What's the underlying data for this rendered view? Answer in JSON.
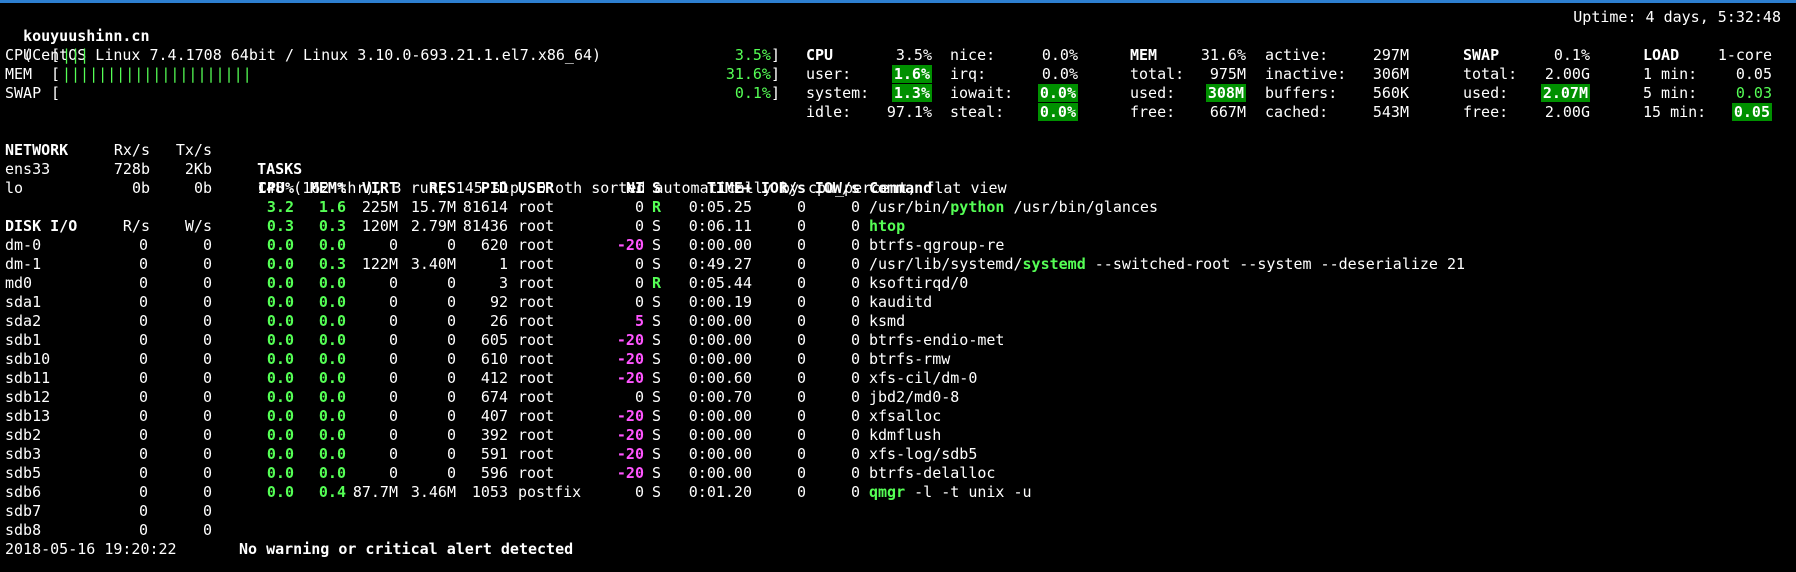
{
  "header": {
    "hostname": "kouyuushinn.cn",
    "system": "(CentOS Linux 7.4.1708 64bit / Linux 3.10.0-693.21.1.el7.x86_64)",
    "uptime": "Uptime: 4 days, 5:32:48"
  },
  "quicklook": [
    {
      "label": "CPU",
      "bar": "|||",
      "pct": "3.5%]"
    },
    {
      "label": "MEM",
      "bar": "|||||||||||||||||||||",
      "pct": "31.6%]"
    },
    {
      "label": "SWAP",
      "bar": "",
      "pct": "0.1%]"
    }
  ],
  "cpu": {
    "title": "CPU",
    "total": "3.5%",
    "user_label": "user:",
    "user": "1.6%",
    "system_label": "system:",
    "system": "1.3%",
    "idle_label": "idle:",
    "idle": "97.1%",
    "nice_label": "nice:",
    "nice": "0.0%",
    "irq_label": "irq:",
    "irq": "0.0%",
    "iowait_label": "iowait:",
    "iowait": "0.0%",
    "steal_label": "steal:",
    "steal": "0.0%"
  },
  "mem": {
    "title": "MEM",
    "pct": "31.6%",
    "total_label": "total:",
    "total": "975M",
    "used_label": "used:",
    "used": "308M",
    "free_label": "free:",
    "free": "667M",
    "active_label": "active:",
    "active": "297M",
    "inactive_label": "inactive:",
    "inactive": "306M",
    "buffers_label": "buffers:",
    "buffers": "560K",
    "cached_label": "cached:",
    "cached": "543M"
  },
  "swap": {
    "title": "SWAP",
    "pct": "0.1%",
    "total_label": "total:",
    "total": "2.00G",
    "used_label": "used:",
    "used": "2.07M",
    "free_label": "free:",
    "free": "2.00G"
  },
  "load": {
    "title": "LOAD",
    "cores": "1-core",
    "min1_label": "1 min:",
    "min1": "0.05",
    "min5_label": "5 min:",
    "min5": "0.03",
    "min15_label": "15 min:",
    "min15": "0.05"
  },
  "network": {
    "title": "NETWORK",
    "rx_header": "Rx/s",
    "tx_header": "Tx/s",
    "rows": [
      {
        "name": "ens33",
        "rx": "728b",
        "tx": "2Kb"
      },
      {
        "name": "lo",
        "rx": "0b",
        "tx": "0b"
      }
    ]
  },
  "disk": {
    "title": "DISK I/O",
    "r_header": "R/s",
    "w_header": "W/s",
    "rows": [
      {
        "name": "dm-0",
        "r": "0",
        "w": "0"
      },
      {
        "name": "dm-1",
        "r": "0",
        "w": "0"
      },
      {
        "name": "md0",
        "r": "0",
        "w": "0"
      },
      {
        "name": "sda1",
        "r": "0",
        "w": "0"
      },
      {
        "name": "sda2",
        "r": "0",
        "w": "0"
      },
      {
        "name": "sdb1",
        "r": "0",
        "w": "0"
      },
      {
        "name": "sdb10",
        "r": "0",
        "w": "0"
      },
      {
        "name": "sdb11",
        "r": "0",
        "w": "0"
      },
      {
        "name": "sdb12",
        "r": "0",
        "w": "0"
      },
      {
        "name": "sdb13",
        "r": "0",
        "w": "0"
      },
      {
        "name": "sdb2",
        "r": "0",
        "w": "0"
      },
      {
        "name": "sdb3",
        "r": "0",
        "w": "0"
      },
      {
        "name": "sdb5",
        "r": "0",
        "w": "0"
      },
      {
        "name": "sdb6",
        "r": "0",
        "w": "0"
      },
      {
        "name": "sdb7",
        "r": "0",
        "w": "0"
      },
      {
        "name": "sdb8",
        "r": "0",
        "w": "0"
      }
    ]
  },
  "tasks": {
    "title": "TASKS",
    "summary": "148 (162 thr), 3 run, 145 slp, 0 oth sorted automatically by cpu_percent, flat view"
  },
  "process_headers": [
    "CPU%",
    "MEM%",
    "VIRT",
    "RES",
    "PID",
    "USER",
    "NI",
    "S",
    "TIME+",
    "IOR/s",
    "IOW/s",
    "Command"
  ],
  "processes": [
    {
      "cpu": "3.2",
      "mem": "1.6",
      "virt": "225M",
      "res": "15.7M",
      "pid": "81614",
      "user": "root",
      "ni": "0",
      "ni_neg": false,
      "s": "R",
      "time": "0:05.25",
      "ior": "0",
      "iow": "0",
      "cmd_pre": "/usr/bin/",
      "cmd_hl": "python",
      "cmd_post": " /usr/bin/glances",
      "hot": true
    },
    {
      "cpu": "0.3",
      "mem": "0.3",
      "virt": "120M",
      "res": "2.79M",
      "pid": "81436",
      "user": "root",
      "ni": "0",
      "ni_neg": false,
      "s": "S",
      "time": "0:06.11",
      "ior": "0",
      "iow": "0",
      "cmd_pre": "",
      "cmd_hl": "htop",
      "cmd_post": "",
      "hot": true
    },
    {
      "cpu": "0.0",
      "mem": "0.0",
      "virt": "0",
      "res": "0",
      "pid": "620",
      "user": "root",
      "ni": "-20",
      "ni_neg": true,
      "s": "S",
      "time": "0:00.00",
      "ior": "0",
      "iow": "0",
      "cmd_pre": "btrfs-qgroup-re",
      "cmd_hl": "",
      "cmd_post": "",
      "hot": false
    },
    {
      "cpu": "0.0",
      "mem": "0.3",
      "virt": "122M",
      "res": "3.40M",
      "pid": "1",
      "user": "root",
      "ni": "0",
      "ni_neg": false,
      "s": "S",
      "time": "0:49.27",
      "ior": "0",
      "iow": "0",
      "cmd_pre": "/usr/lib/systemd/",
      "cmd_hl": "systemd",
      "cmd_post": " --switched-root --system --deserialize 21",
      "hot": false
    },
    {
      "cpu": "0.0",
      "mem": "0.0",
      "virt": "0",
      "res": "0",
      "pid": "3",
      "user": "root",
      "ni": "0",
      "ni_neg": false,
      "s": "R",
      "time": "0:05.44",
      "ior": "0",
      "iow": "0",
      "cmd_pre": "ksoftirqd/0",
      "cmd_hl": "",
      "cmd_post": "",
      "hot": false
    },
    {
      "cpu": "0.0",
      "mem": "0.0",
      "virt": "0",
      "res": "0",
      "pid": "92",
      "user": "root",
      "ni": "0",
      "ni_neg": false,
      "s": "S",
      "time": "0:00.19",
      "ior": "0",
      "iow": "0",
      "cmd_pre": "kauditd",
      "cmd_hl": "",
      "cmd_post": "",
      "hot": false
    },
    {
      "cpu": "0.0",
      "mem": "0.0",
      "virt": "0",
      "res": "0",
      "pid": "26",
      "user": "root",
      "ni": "5",
      "ni_neg": true,
      "s": "S",
      "time": "0:00.00",
      "ior": "0",
      "iow": "0",
      "cmd_pre": "ksmd",
      "cmd_hl": "",
      "cmd_post": "",
      "hot": false
    },
    {
      "cpu": "0.0",
      "mem": "0.0",
      "virt": "0",
      "res": "0",
      "pid": "605",
      "user": "root",
      "ni": "-20",
      "ni_neg": true,
      "s": "S",
      "time": "0:00.00",
      "ior": "0",
      "iow": "0",
      "cmd_pre": "btrfs-endio-met",
      "cmd_hl": "",
      "cmd_post": "",
      "hot": false
    },
    {
      "cpu": "0.0",
      "mem": "0.0",
      "virt": "0",
      "res": "0",
      "pid": "610",
      "user": "root",
      "ni": "-20",
      "ni_neg": true,
      "s": "S",
      "time": "0:00.00",
      "ior": "0",
      "iow": "0",
      "cmd_pre": "btrfs-rmw",
      "cmd_hl": "",
      "cmd_post": "",
      "hot": false
    },
    {
      "cpu": "0.0",
      "mem": "0.0",
      "virt": "0",
      "res": "0",
      "pid": "412",
      "user": "root",
      "ni": "-20",
      "ni_neg": true,
      "s": "S",
      "time": "0:00.60",
      "ior": "0",
      "iow": "0",
      "cmd_pre": "xfs-cil/dm-0",
      "cmd_hl": "",
      "cmd_post": "",
      "hot": false
    },
    {
      "cpu": "0.0",
      "mem": "0.0",
      "virt": "0",
      "res": "0",
      "pid": "674",
      "user": "root",
      "ni": "0",
      "ni_neg": false,
      "s": "S",
      "time": "0:00.70",
      "ior": "0",
      "iow": "0",
      "cmd_pre": "jbd2/md0-8",
      "cmd_hl": "",
      "cmd_post": "",
      "hot": false
    },
    {
      "cpu": "0.0",
      "mem": "0.0",
      "virt": "0",
      "res": "0",
      "pid": "407",
      "user": "root",
      "ni": "-20",
      "ni_neg": true,
      "s": "S",
      "time": "0:00.00",
      "ior": "0",
      "iow": "0",
      "cmd_pre": "xfsalloc",
      "cmd_hl": "",
      "cmd_post": "",
      "hot": false
    },
    {
      "cpu": "0.0",
      "mem": "0.0",
      "virt": "0",
      "res": "0",
      "pid": "392",
      "user": "root",
      "ni": "-20",
      "ni_neg": true,
      "s": "S",
      "time": "0:00.00",
      "ior": "0",
      "iow": "0",
      "cmd_pre": "kdmflush",
      "cmd_hl": "",
      "cmd_post": "",
      "hot": false
    },
    {
      "cpu": "0.0",
      "mem": "0.0",
      "virt": "0",
      "res": "0",
      "pid": "591",
      "user": "root",
      "ni": "-20",
      "ni_neg": true,
      "s": "S",
      "time": "0:00.00",
      "ior": "0",
      "iow": "0",
      "cmd_pre": "xfs-log/sdb5",
      "cmd_hl": "",
      "cmd_post": "",
      "hot": false
    },
    {
      "cpu": "0.0",
      "mem": "0.0",
      "virt": "0",
      "res": "0",
      "pid": "596",
      "user": "root",
      "ni": "-20",
      "ni_neg": true,
      "s": "S",
      "time": "0:00.00",
      "ior": "0",
      "iow": "0",
      "cmd_pre": "btrfs-delalloc",
      "cmd_hl": "",
      "cmd_post": "",
      "hot": false
    },
    {
      "cpu": "0.0",
      "mem": "0.4",
      "virt": "87.7M",
      "res": "3.46M",
      "pid": "1053",
      "user": "postfix",
      "ni": "0",
      "ni_neg": false,
      "s": "S",
      "time": "0:01.20",
      "ior": "0",
      "iow": "0",
      "cmd_pre": "",
      "cmd_hl": "qmgr",
      "cmd_post": " -l -t unix -u",
      "hot": false
    }
  ],
  "footer": {
    "datetime": "2018-05-16 19:20:22",
    "alert": "No warning or critical alert detected"
  },
  "colors": {
    "ok_green": "#55ff55",
    "highlight_bg": "#009000",
    "nice_magenta": "#ff55ff",
    "topbar_blue": "#2d7fd0"
  }
}
